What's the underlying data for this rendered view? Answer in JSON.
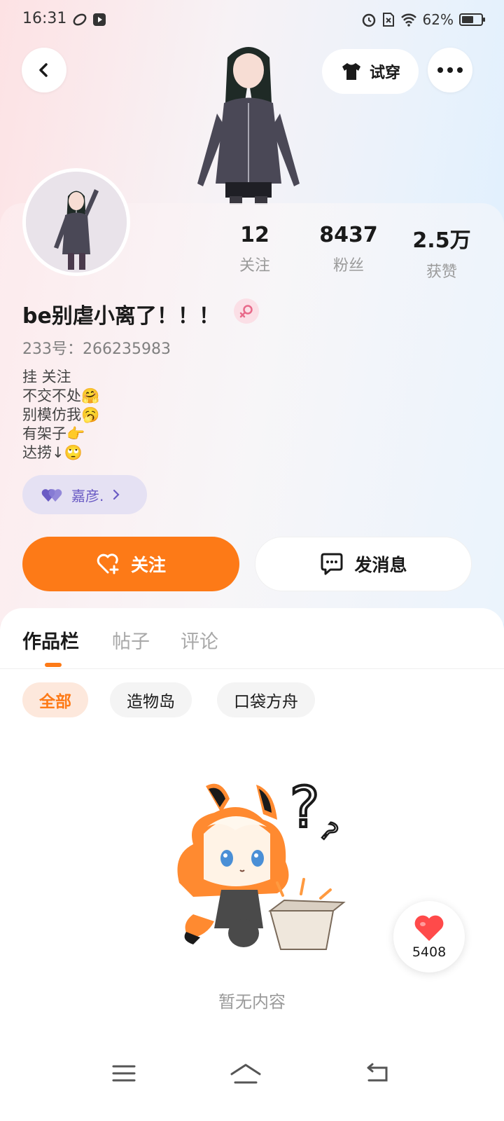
{
  "status_bar": {
    "time": "16:31",
    "battery": "62%",
    "battery_level": 0.62
  },
  "header": {
    "try_on_label": "试穿"
  },
  "stats": [
    {
      "value": "12",
      "label": "关注"
    },
    {
      "value": "8437",
      "label": "粉丝"
    },
    {
      "value": "2.5万",
      "label": "获赞"
    }
  ],
  "profile": {
    "name": "be别虐小离了！！！",
    "uid": "233号：266235983",
    "bio": [
      "挂 关注",
      "不交不处🤗",
      "别模仿我🥱",
      "有架子👉",
      "达捞↓🙄"
    ],
    "relation_name": "嘉彦.",
    "gender": "female"
  },
  "actions": {
    "follow_label": "关注",
    "message_label": "发消息"
  },
  "tabs": [
    {
      "label": "作品栏",
      "active": true
    },
    {
      "label": "帖子",
      "active": false
    },
    {
      "label": "评论",
      "active": false
    }
  ],
  "filters": [
    {
      "label": "全部",
      "active": true
    },
    {
      "label": "造物岛",
      "active": false
    },
    {
      "label": "口袋方舟",
      "active": false
    }
  ],
  "empty_state": {
    "text": "暂无内容"
  },
  "like_float": {
    "count": "5408"
  },
  "colors": {
    "accent": "#fd7a17",
    "relation": "#6a5bc4",
    "gender": "#e86a8a"
  }
}
